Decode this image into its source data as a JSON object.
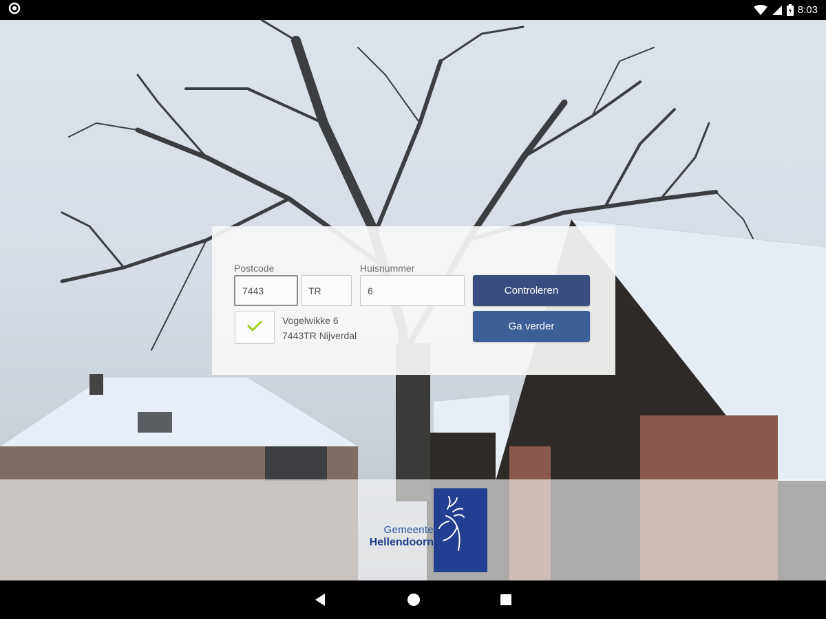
{
  "status_bar": {
    "time": "8:03",
    "icons": [
      "notification-circle-icon",
      "wifi-icon",
      "signal-icon",
      "battery-icon"
    ]
  },
  "form": {
    "postcode_label": "Postcode",
    "postcode_digits_value": "7443",
    "postcode_letters_value": "TR",
    "huisnummer_label": "Huisnummer",
    "huisnummer_value": "6",
    "verified_icon": "checkmark-icon",
    "address_line1": "Vogelwikke 6",
    "address_line2": "7443TR Nijverdal"
  },
  "buttons": {
    "check_label": "Controleren",
    "continue_label": "Ga verder"
  },
  "logo": {
    "line1": "Gemeente",
    "line2": "Hellendoorn",
    "emblem_icon": "deer-emblem-icon"
  },
  "nav_bar": {
    "icons": [
      "back-icon",
      "home-icon",
      "recents-icon"
    ]
  },
  "colors": {
    "button_primary": "#3c5f98",
    "button_dark": "#374e7f",
    "checkmark": "#9ccd1f",
    "logo_blue": "#223f92"
  }
}
